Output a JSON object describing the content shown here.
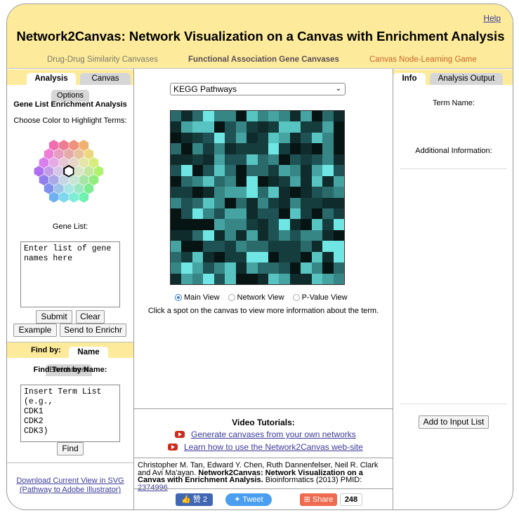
{
  "header": {
    "help": "Help",
    "title": "Network2Canvas: Network Visualization on a Canvas with Enrichment Analysis",
    "nav": [
      {
        "label": "Drug-Drug Similarity Canvases"
      },
      {
        "label": "Functional Association Gene Canvases"
      },
      {
        "label": "Canvas Node-Learning Game"
      }
    ]
  },
  "left": {
    "tabs": {
      "analysis": "Analysis",
      "canvas": "Canvas",
      "options": "Options"
    },
    "section_title": "Gene List Enrichment Analysis",
    "color_prompt": "Choose Color to Highlight Terms:",
    "gene_list_label": "Gene List:",
    "gene_placeholder": "Enter list of gene names here",
    "buttons": {
      "submit": "Submit",
      "clear": "Clear",
      "example": "Example",
      "enrichr": "Send to Enrichr"
    },
    "findby": {
      "label": "Find by:",
      "name_tab": "Name",
      "overlap_text": "Find Term by Name:",
      "overlap_tab": "Enrichment"
    },
    "term_list": "Insert Term List\n(e.g.,\nCDK1\nCDK2\nCDK3)",
    "find_button": "Find",
    "download_link": "Download Current View in SVG (Pathway to Adobe Illustrator)"
  },
  "center": {
    "dropdown": "KEGG Pathways",
    "views": [
      {
        "label": "Main View",
        "selected": true
      },
      {
        "label": "Network View",
        "selected": false
      },
      {
        "label": "P-Value View",
        "selected": false
      }
    ],
    "hint": "Click a spot on the canvas to view more information about the term.",
    "video_title": "Video Tutorials:",
    "videos": [
      {
        "label": "Generate canvases from your own networks"
      },
      {
        "label": "Learn how to use the Network2Canvas web-site"
      }
    ],
    "citation_authors": "Christopher M. Tan, Edward Y. Chen, Ruth Dannenfelser, Neil R. Clark and Avi Ma'ayan.",
    "citation_title": "Network2Canvas: Network Visualization on a Canvas with Enrichment Analysis.",
    "citation_journal": "Bioinformatics (2013) PMID:",
    "pmid": "2374996",
    "social": {
      "like": "赞 2",
      "tweet": "Tweet",
      "share": "Share",
      "share_count": "248"
    },
    "canvas_colors": [
      "#071414",
      "#0f2b2b",
      "#163d3e",
      "#1f5254",
      "#2a6a6b",
      "#378686",
      "#45a3a2",
      "#58c4c1",
      "#6fe6e4"
    ]
  },
  "right": {
    "tabs": {
      "info": "Info",
      "output": "Analysis Output"
    },
    "term_label": "Term Name:",
    "additional_label": "Additional Information:",
    "add_button": "Add to Input List"
  }
}
